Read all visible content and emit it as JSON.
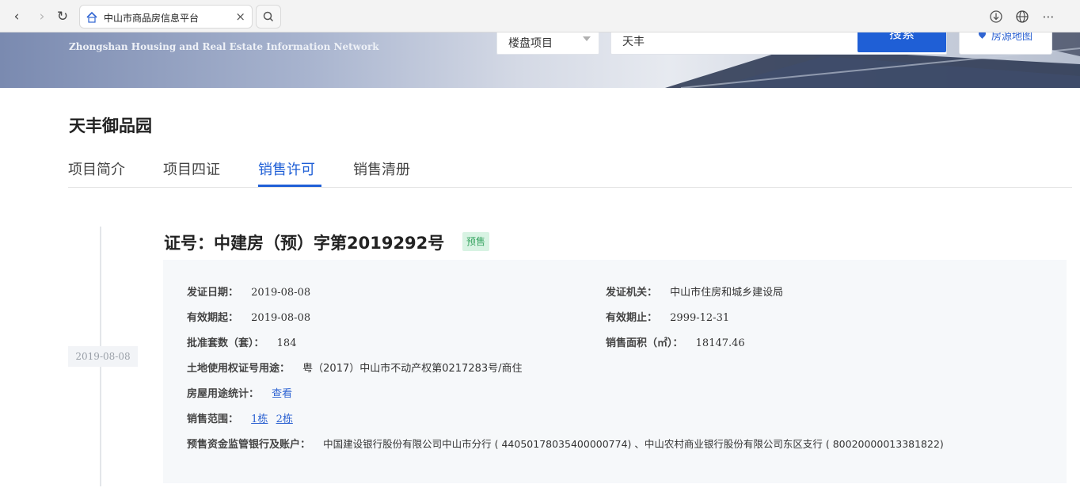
{
  "browser": {
    "tab_title": "中山市商品房信息平台",
    "tab_close": "×"
  },
  "banner": {
    "subtitle": "Zhongshan Housing and Real Estate Information Network",
    "select_value": "楼盘项目",
    "search_value": "天丰",
    "search_button": "搜索",
    "map_button": "房源地图"
  },
  "project": {
    "title": "天丰御品园",
    "tabs": [
      {
        "label": "项目简介"
      },
      {
        "label": "项目四证"
      },
      {
        "label": "销售许可"
      },
      {
        "label": "销售清册"
      }
    ]
  },
  "timeline": {
    "date": "2019-08-08"
  },
  "certificate": {
    "heading": "证号：中建房（预）字第2019292号",
    "badge": "预售",
    "fields": {
      "issue_date_label": "发证日期：",
      "issue_date": "2019-08-08",
      "authority_label": "发证机关：",
      "authority": "中山市住房和城乡建设局",
      "valid_from_label": "有效期起：",
      "valid_from": "2019-08-08",
      "valid_to_label": "有效期止：",
      "valid_to": "2999-12-31",
      "units_label": "批准套数（套）：",
      "units": "184",
      "area_label": "销售面积（㎡）：",
      "area": "18147.46",
      "land_cert_label": "土地使用权证号用途：",
      "land_cert": "粤（2017）中山市不动产权第0217283号/商住",
      "usage_stats_label": "房屋用途统计：",
      "usage_stats_link": "查看",
      "sale_scope_label": "销售范围：",
      "sale_scope_1": "1栋",
      "sale_scope_2": "2栋",
      "bank_label": "预售资金监管银行及账户：",
      "bank": "中国建设银行股份有限公司中山市分行 ( 44050178035400000774) 、中山农村商业银行股份有限公司东区支行 ( 80020000013381822)"
    }
  },
  "colors": {
    "accent": "#1f5fd6",
    "badge_bg": "#d8f3e3",
    "badge_text": "#3aa563"
  }
}
